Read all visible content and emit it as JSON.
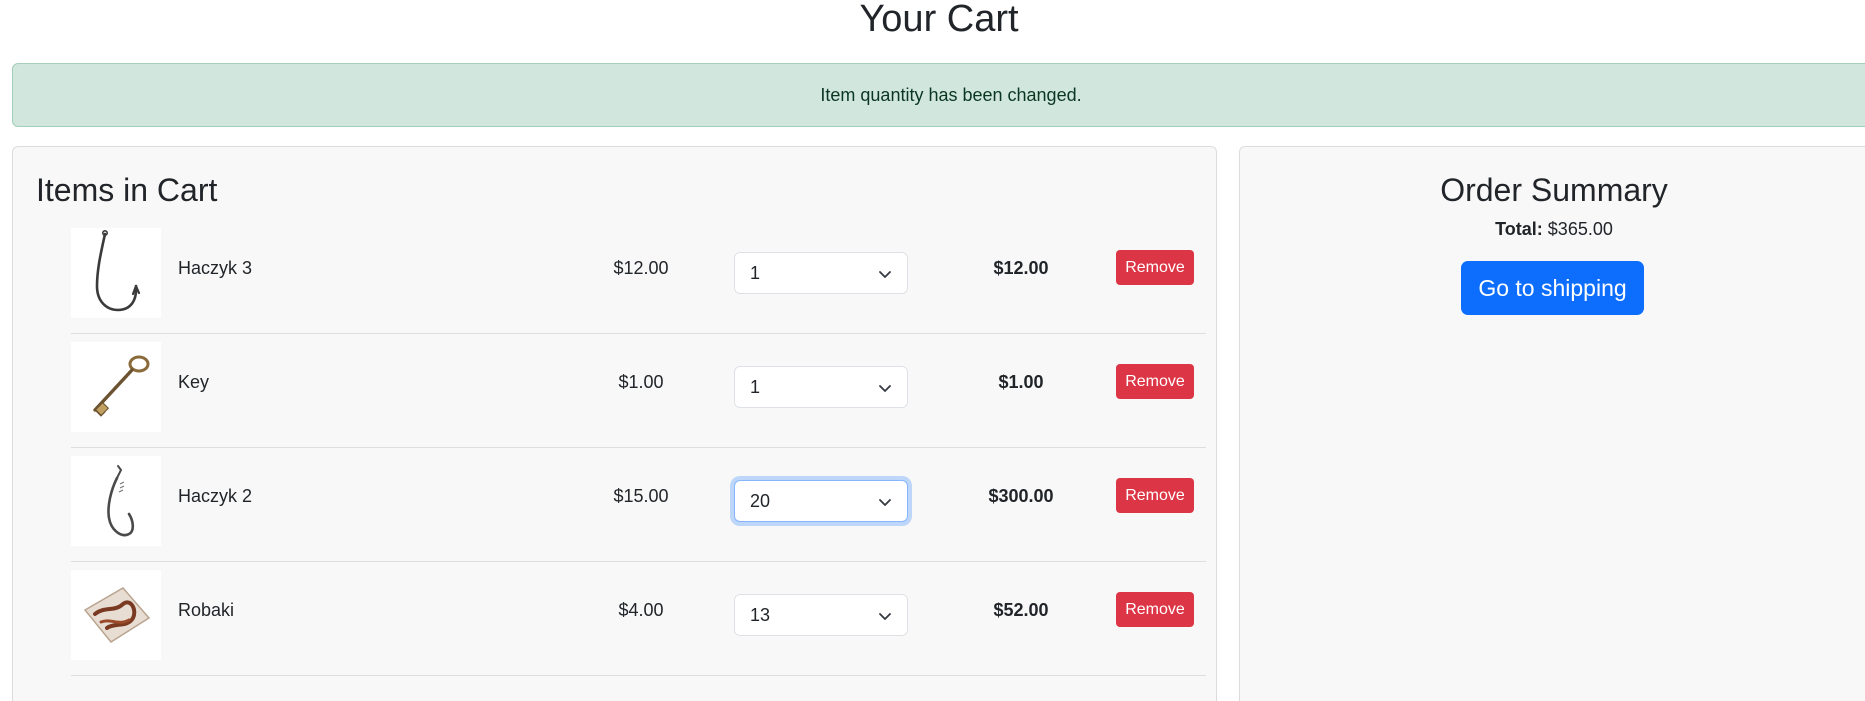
{
  "page": {
    "title": "Your Cart"
  },
  "alert": {
    "message": "Item quantity has been changed."
  },
  "cart": {
    "title": "Items in Cart",
    "remove_label": "Remove",
    "items": [
      {
        "name": "Haczyk 3",
        "price": "$12.00",
        "quantity": "1",
        "subtotal": "$12.00",
        "image_icon": "fishing-hook-icon"
      },
      {
        "name": "Key",
        "price": "$1.00",
        "quantity": "1",
        "subtotal": "$1.00",
        "image_icon": "key-icon"
      },
      {
        "name": "Haczyk 2",
        "price": "$15.00",
        "quantity": "20",
        "subtotal": "$300.00",
        "image_icon": "fishing-hook-icon"
      },
      {
        "name": "Robaki",
        "price": "$4.00",
        "quantity": "13",
        "subtotal": "$52.00",
        "image_icon": "bait-worms-icon"
      }
    ]
  },
  "summary": {
    "title": "Order Summary",
    "total_label": "Total:",
    "total_value": "$365.00",
    "shipping_button": "Go to shipping"
  },
  "colors": {
    "alert_bg": "#d1e7dd",
    "danger": "#dc3545",
    "primary": "#0d6efd",
    "card_bg": "#f8f8f8"
  }
}
